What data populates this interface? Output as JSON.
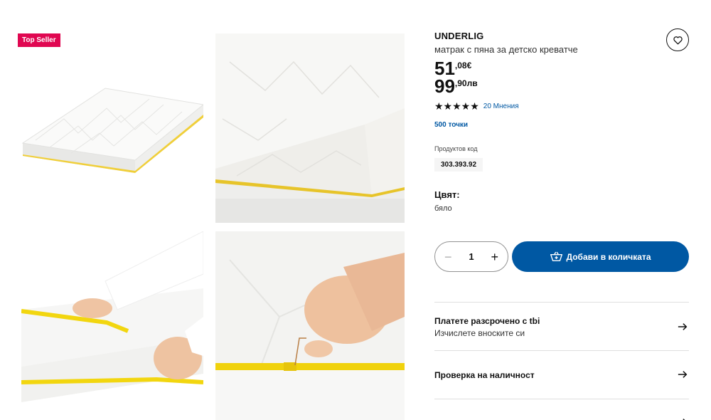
{
  "badge": "Top Seller",
  "product": {
    "brand": "UNDERLIG",
    "subtitle": "матрак с пяна за детско креватче",
    "price_eur_int": "51",
    "price_eur_frac": ",08€",
    "price_bgn_int": "99",
    "price_bgn_frac": ",90лв",
    "stars": "★★★★★",
    "rating": 5,
    "reviews": "20 Мнения",
    "points": "500 точки",
    "code_label": "Продуктов код",
    "code": "303.393.92",
    "color_label": "Цвят:",
    "color_value": "бяло"
  },
  "cart": {
    "quantity": "1",
    "minus": "−",
    "plus": "+",
    "add_label": "Добави в количката"
  },
  "rows": {
    "installments_title": "Платете разсрочено с tbi",
    "installments_sub": "Изчислете вноските си",
    "availability_title": "Проверка на наличност"
  },
  "colors": {
    "accent": "#0058a3",
    "badge": "#e00751",
    "zipper": "#f5d312"
  },
  "icons": [
    "heart-icon",
    "cart-icon",
    "arrow-right-icon"
  ]
}
